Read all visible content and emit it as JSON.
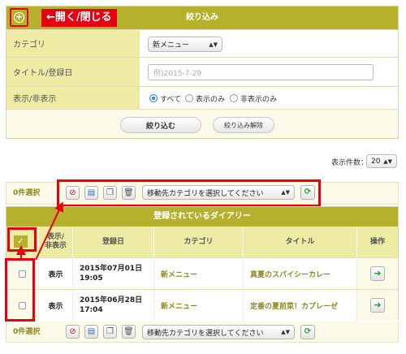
{
  "filter": {
    "title": "絞り込み",
    "toggle_icon": "+",
    "annotation_label": "←開く/閉じる",
    "rows": [
      {
        "label": "カテゴリ",
        "select_value": "新メニュー"
      },
      {
        "label": "タイトル/登録日",
        "placeholder": "例)2015-7-29"
      },
      {
        "label": "表示/非表示",
        "options": [
          "すべて",
          "表示のみ",
          "非表示のみ"
        ],
        "selected": "すべて"
      }
    ],
    "apply_button": "絞り込む",
    "clear_button": "絞り込み解除"
  },
  "per_page": {
    "label": "表示件数：",
    "value": "20"
  },
  "action_bar": {
    "selected_count": "0件選択",
    "move_select_placeholder": "移動先カテゴリを選択してください",
    "icons": [
      "hide-icon",
      "show-icon",
      "copy-icon",
      "trash-icon",
      "move-refresh-icon"
    ]
  },
  "table": {
    "title": "登録されているダイアリー",
    "headers": [
      "",
      "表示/\n非表示",
      "登録日",
      "カテゴリ",
      "タイトル",
      "操作"
    ],
    "rows": [
      {
        "visibility": "表示",
        "date": "2015年07月01日\n19:05",
        "category": "新メニュー",
        "title": "真夏のスパイシーカレー"
      },
      {
        "visibility": "表示",
        "date": "2015年06月28日\n17:04",
        "category": "新メニュー",
        "title": "定番の夏前菜！カプレーゼ"
      }
    ]
  },
  "colors": {
    "accent": "#b5b12d",
    "label_bg": "#eeeca4",
    "annotation": "#e60012",
    "link": "#8a8a20"
  }
}
